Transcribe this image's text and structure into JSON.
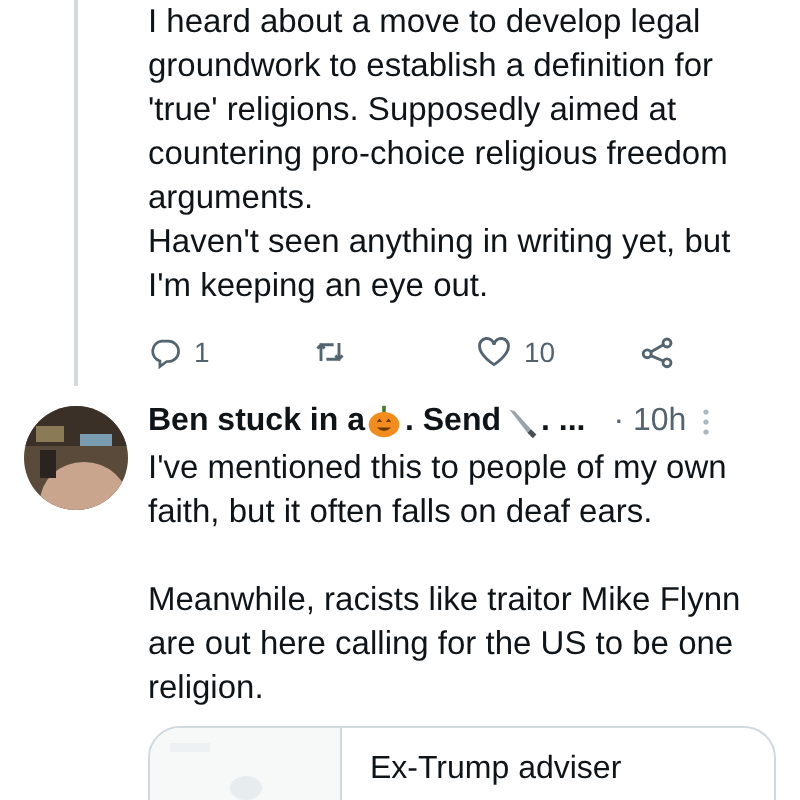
{
  "tweets": [
    {
      "thread_line": true,
      "text": "I heard about a move to develop legal groundwork to  establish a definition for 'true' religions. Supposedly aimed at countering pro-choice religious freedom arguments.\nHaven't seen anything in writing yet, but I'm keeping an eye out.",
      "actions": [
        {
          "kind": "reply",
          "count": "1"
        },
        {
          "kind": "retweet"
        },
        {
          "kind": "like",
          "count": "10"
        },
        {
          "kind": "share"
        }
      ]
    },
    {
      "author": {
        "name_parts": [
          {
            "kind": "text",
            "text": "Ben stuck in a"
          },
          {
            "kind": "pumpkin"
          },
          {
            "kind": "text",
            "text": ". Send"
          },
          {
            "kind": "knife"
          },
          {
            "kind": "text",
            "text": ". ..."
          }
        ],
        "time": "· 10h"
      },
      "text": "I've mentioned this to people of my own faith, but it often falls on deaf ears.\n\nMeanwhile, racists like traitor Mike Flynn are out here calling for the US to be one religion.",
      "card": {
        "title": "Ex-Trump adviser"
      }
    }
  ]
}
